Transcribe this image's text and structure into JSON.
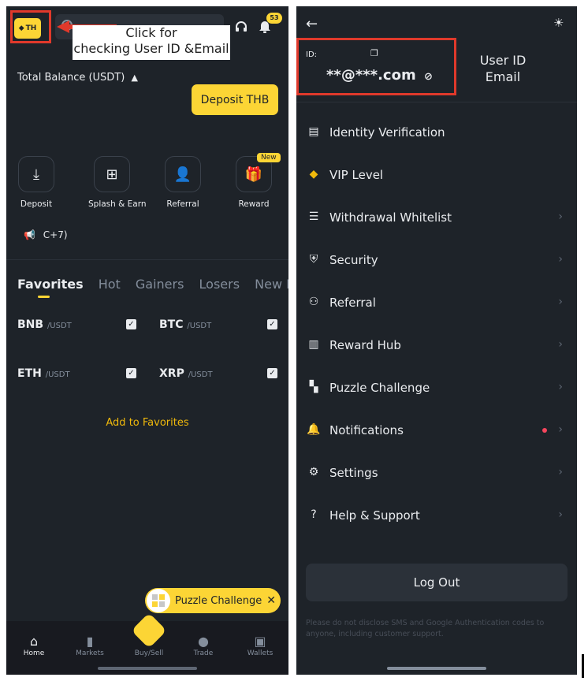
{
  "left": {
    "region_badge": "TH",
    "notification_count": "53",
    "annotation_text": "Click for\nchecking User ID &Email",
    "total_balance_label": "Total Balance (USDT)",
    "deposit_thb_label": "Deposit THB",
    "quick_actions": [
      {
        "label": "Deposit",
        "icon": "deposit-icon"
      },
      {
        "label": "Splash & Earn",
        "icon": "gamepad-icon"
      },
      {
        "label": "Referral",
        "icon": "add-user-icon"
      },
      {
        "label": "Reward",
        "icon": "gift-icon"
      }
    ],
    "new_badge": "New",
    "announcement": "C+7)",
    "market_tabs": [
      "Favorites",
      "Hot",
      "Gainers",
      "Losers",
      "New Listin"
    ],
    "favorites": [
      {
        "base": "BNB",
        "quote": "/USDT"
      },
      {
        "base": "BTC",
        "quote": "/USDT"
      },
      {
        "base": "ETH",
        "quote": "/USDT"
      },
      {
        "base": "XRP",
        "quote": "/USDT"
      }
    ],
    "add_to_favorites": "Add to Favorites",
    "puzzle_pill": "Puzzle Challenge",
    "nav": [
      {
        "label": "Home",
        "icon": "home-icon"
      },
      {
        "label": "Markets",
        "icon": "bar-chart-icon"
      },
      {
        "label": "Buy/Sell",
        "icon": "buysell-icon"
      },
      {
        "label": "Trade",
        "icon": "trade-icon"
      },
      {
        "label": "Wallets",
        "icon": "wallet-icon"
      }
    ]
  },
  "right": {
    "id_label": "ID:",
    "email_masked": "**@***.com",
    "annotation_text": "User ID\nEmail",
    "menu": [
      {
        "label": "Identity Verification",
        "icon": "id-card-icon",
        "chevron": false
      },
      {
        "label": "VIP Level",
        "icon": "diamond-icon",
        "chevron": false
      },
      {
        "label": "Withdrawal Whitelist",
        "icon": "list-icon",
        "chevron": true
      },
      {
        "label": "Security",
        "icon": "shield-icon",
        "chevron": true
      },
      {
        "label": "Referral",
        "icon": "add-user-icon",
        "chevron": true
      },
      {
        "label": "Reward Hub",
        "icon": "reward-icon",
        "chevron": true
      },
      {
        "label": "Puzzle Challenge",
        "icon": "puzzle-icon",
        "chevron": true
      },
      {
        "label": "Notifications",
        "icon": "bell-icon",
        "chevron": true
      },
      {
        "label": "Settings",
        "icon": "gear-icon",
        "chevron": true
      },
      {
        "label": "Help & Support",
        "icon": "help-icon",
        "chevron": true
      }
    ],
    "logout_label": "Log Out",
    "disclaimer": "Please do not disclose SMS and Google Authentication codes to anyone, including customer support."
  },
  "colors": {
    "accent": "#fcd535",
    "background": "#1e2329",
    "annotation_red": "#e0392b"
  }
}
